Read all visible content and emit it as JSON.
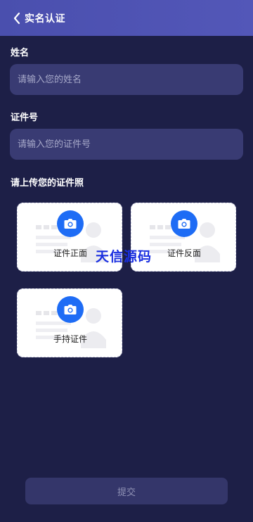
{
  "header": {
    "title": "实名认证"
  },
  "form": {
    "name_label": "姓名",
    "name_placeholder": "请输入您的姓名",
    "id_label": "证件号",
    "id_placeholder": "请输入您的证件号",
    "upload_label": "请上传您的证件照"
  },
  "uploads": [
    {
      "label": "证件正面",
      "icon": "camera-icon"
    },
    {
      "label": "证件反面",
      "icon": "camera-icon"
    },
    {
      "label": "手持证件",
      "icon": "camera-icon"
    }
  ],
  "watermark": "天信源码",
  "submit_label": "提交",
  "colors": {
    "background": "#1d1f47",
    "header": "#5054b4",
    "field": "#393b73",
    "accent": "#1e6cf5",
    "button": "#34366a"
  }
}
